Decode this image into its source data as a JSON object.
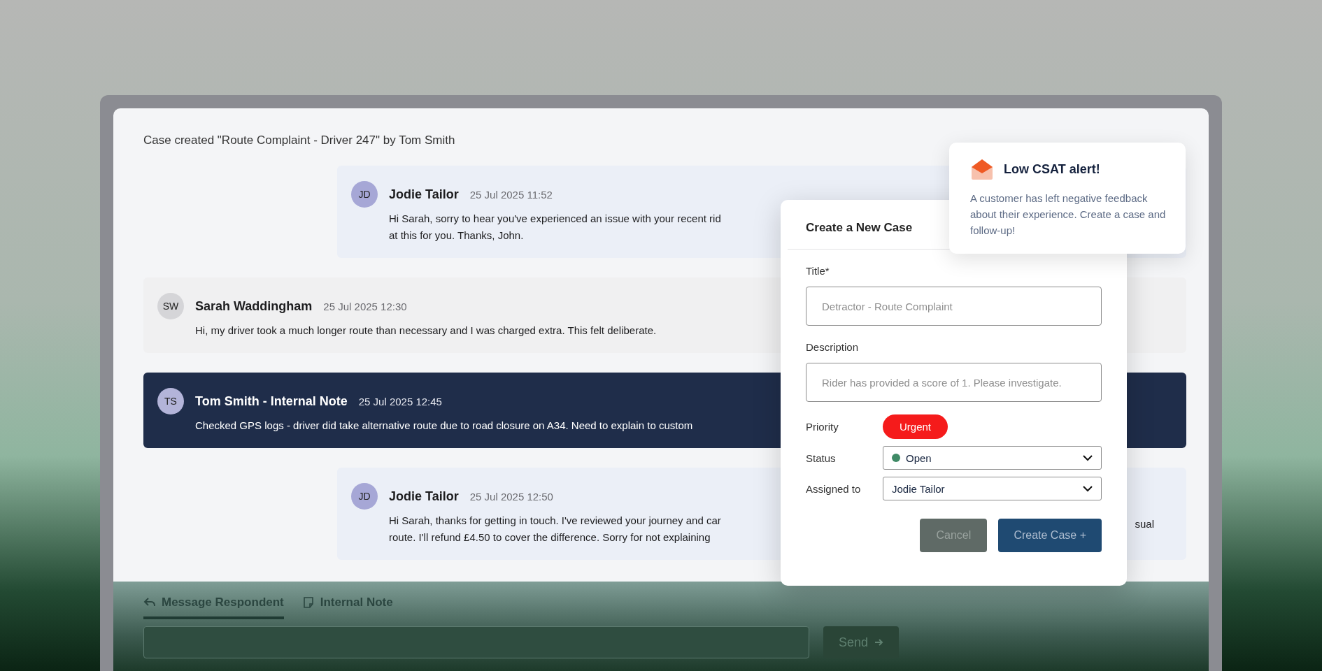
{
  "timeline": {
    "event": "Case created \"Route Complaint - Driver 247\" by Tom Smith"
  },
  "messages": [
    {
      "kind": "agent",
      "initials": "JD",
      "author": "Jodie Tailor",
      "time": "25 Jul 2025 11:52",
      "lines": [
        "Hi Sarah, sorry to hear you've experienced an issue with your recent rid",
        "at this for you. Thanks, John."
      ]
    },
    {
      "kind": "customer",
      "initials": "SW",
      "author": "Sarah Waddingham",
      "time": "25 Jul 2025 12:30",
      "lines": [
        "Hi, my driver took a much longer route than necessary and I was charged extra. This felt deliberate."
      ]
    },
    {
      "kind": "note",
      "initials": "TS",
      "author": "Tom Smith - **Internal Note**",
      "time": "25 Jul 2025 12:45",
      "lines": [
        "Checked GPS logs - driver did take alternative route due to road closure on A34. Need to explain to custom"
      ]
    },
    {
      "kind": "agent",
      "initials": "JD",
      "author": "Jodie Tailor",
      "time": "25 Jul 2025 12:50",
      "lines": [
        "Hi Sarah, thanks for getting in touch. I've reviewed your journey and car",
        "route. I'll refund £4.50 to cover the difference. Sorry for not explaining"
      ],
      "tail": "sual"
    }
  ],
  "composer": {
    "tabs": [
      {
        "label": "Message Respondent",
        "kind": "reply",
        "selected": true
      },
      {
        "label": "Internal Note",
        "kind": "note",
        "selected": false
      }
    ],
    "send_button": "Send"
  },
  "modal": {
    "title": "Create a New Case",
    "fields": [
      {
        "kind": "text",
        "label": "Title*",
        "placeholder": "Detractor - Route Complaint"
      },
      {
        "kind": "text",
        "label": "Description",
        "placeholder": "Rider has provided a score of 1. Please investigate."
      },
      {
        "kind": "pill",
        "label": "Priority",
        "value": "Urgent"
      },
      {
        "kind": "select",
        "label": "Status",
        "value": "Open",
        "dot": true
      },
      {
        "kind": "select",
        "label": "Assigned to",
        "value": "Jodie Tailor"
      }
    ],
    "buttons": [
      {
        "label": "Cancel",
        "kind": "secondary"
      },
      {
        "label": "Create Case +",
        "kind": "primary"
      }
    ]
  },
  "alert": {
    "title": "Low CSAT alert!",
    "body": "A customer has left negative feedback about their experience. Create a case and follow-up!"
  }
}
